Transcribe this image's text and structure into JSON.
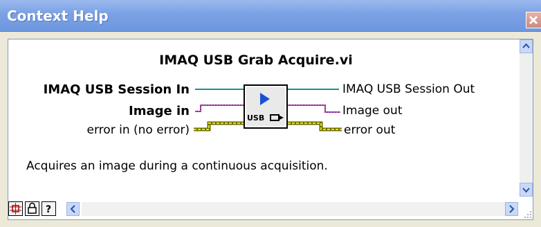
{
  "window": {
    "title": "Context Help",
    "close_icon": "close-icon"
  },
  "help": {
    "vi_title": "IMAQ USB Grab Acquire.vi",
    "inputs": [
      "IMAQ USB Session In",
      "Image in",
      "error in (no error)"
    ],
    "outputs": [
      "IMAQ USB Session Out",
      "Image out",
      "error out"
    ],
    "icon_label": "USB",
    "description": "Acquires an image during a continuous acquisition."
  },
  "colors": {
    "titlebar": "#7aa1e4",
    "session_wire": "#1f8f8f",
    "image_wire": "#8a2a8a",
    "error_wire": "#c8c800"
  },
  "toolbar": {
    "icons": [
      "show-optional-terminals-icon",
      "lock-icon",
      "detailed-help-icon",
      "scroll-left-icon"
    ]
  }
}
